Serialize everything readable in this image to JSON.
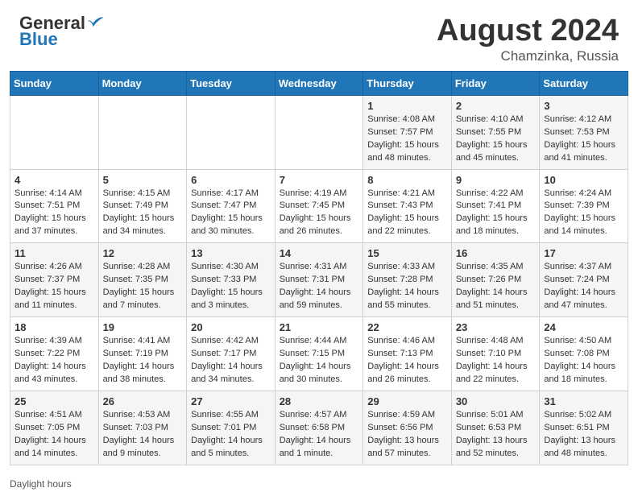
{
  "header": {
    "logo": {
      "general": "General",
      "blue": "Blue"
    },
    "month_year": "August 2024",
    "location": "Chamzinka, Russia"
  },
  "days_of_week": [
    "Sunday",
    "Monday",
    "Tuesday",
    "Wednesday",
    "Thursday",
    "Friday",
    "Saturday"
  ],
  "weeks": [
    [
      {
        "day": "",
        "sunrise": "",
        "sunset": "",
        "daylight": ""
      },
      {
        "day": "",
        "sunrise": "",
        "sunset": "",
        "daylight": ""
      },
      {
        "day": "",
        "sunrise": "",
        "sunset": "",
        "daylight": ""
      },
      {
        "day": "",
        "sunrise": "",
        "sunset": "",
        "daylight": ""
      },
      {
        "day": "1",
        "sunrise": "Sunrise: 4:08 AM",
        "sunset": "Sunset: 7:57 PM",
        "daylight": "Daylight: 15 hours and 48 minutes."
      },
      {
        "day": "2",
        "sunrise": "Sunrise: 4:10 AM",
        "sunset": "Sunset: 7:55 PM",
        "daylight": "Daylight: 15 hours and 45 minutes."
      },
      {
        "day": "3",
        "sunrise": "Sunrise: 4:12 AM",
        "sunset": "Sunset: 7:53 PM",
        "daylight": "Daylight: 15 hours and 41 minutes."
      }
    ],
    [
      {
        "day": "4",
        "sunrise": "Sunrise: 4:14 AM",
        "sunset": "Sunset: 7:51 PM",
        "daylight": "Daylight: 15 hours and 37 minutes."
      },
      {
        "day": "5",
        "sunrise": "Sunrise: 4:15 AM",
        "sunset": "Sunset: 7:49 PM",
        "daylight": "Daylight: 15 hours and 34 minutes."
      },
      {
        "day": "6",
        "sunrise": "Sunrise: 4:17 AM",
        "sunset": "Sunset: 7:47 PM",
        "daylight": "Daylight: 15 hours and 30 minutes."
      },
      {
        "day": "7",
        "sunrise": "Sunrise: 4:19 AM",
        "sunset": "Sunset: 7:45 PM",
        "daylight": "Daylight: 15 hours and 26 minutes."
      },
      {
        "day": "8",
        "sunrise": "Sunrise: 4:21 AM",
        "sunset": "Sunset: 7:43 PM",
        "daylight": "Daylight: 15 hours and 22 minutes."
      },
      {
        "day": "9",
        "sunrise": "Sunrise: 4:22 AM",
        "sunset": "Sunset: 7:41 PM",
        "daylight": "Daylight: 15 hours and 18 minutes."
      },
      {
        "day": "10",
        "sunrise": "Sunrise: 4:24 AM",
        "sunset": "Sunset: 7:39 PM",
        "daylight": "Daylight: 15 hours and 14 minutes."
      }
    ],
    [
      {
        "day": "11",
        "sunrise": "Sunrise: 4:26 AM",
        "sunset": "Sunset: 7:37 PM",
        "daylight": "Daylight: 15 hours and 11 minutes."
      },
      {
        "day": "12",
        "sunrise": "Sunrise: 4:28 AM",
        "sunset": "Sunset: 7:35 PM",
        "daylight": "Daylight: 15 hours and 7 minutes."
      },
      {
        "day": "13",
        "sunrise": "Sunrise: 4:30 AM",
        "sunset": "Sunset: 7:33 PM",
        "daylight": "Daylight: 15 hours and 3 minutes."
      },
      {
        "day": "14",
        "sunrise": "Sunrise: 4:31 AM",
        "sunset": "Sunset: 7:31 PM",
        "daylight": "Daylight: 14 hours and 59 minutes."
      },
      {
        "day": "15",
        "sunrise": "Sunrise: 4:33 AM",
        "sunset": "Sunset: 7:28 PM",
        "daylight": "Daylight: 14 hours and 55 minutes."
      },
      {
        "day": "16",
        "sunrise": "Sunrise: 4:35 AM",
        "sunset": "Sunset: 7:26 PM",
        "daylight": "Daylight: 14 hours and 51 minutes."
      },
      {
        "day": "17",
        "sunrise": "Sunrise: 4:37 AM",
        "sunset": "Sunset: 7:24 PM",
        "daylight": "Daylight: 14 hours and 47 minutes."
      }
    ],
    [
      {
        "day": "18",
        "sunrise": "Sunrise: 4:39 AM",
        "sunset": "Sunset: 7:22 PM",
        "daylight": "Daylight: 14 hours and 43 minutes."
      },
      {
        "day": "19",
        "sunrise": "Sunrise: 4:41 AM",
        "sunset": "Sunset: 7:19 PM",
        "daylight": "Daylight: 14 hours and 38 minutes."
      },
      {
        "day": "20",
        "sunrise": "Sunrise: 4:42 AM",
        "sunset": "Sunset: 7:17 PM",
        "daylight": "Daylight: 14 hours and 34 minutes."
      },
      {
        "day": "21",
        "sunrise": "Sunrise: 4:44 AM",
        "sunset": "Sunset: 7:15 PM",
        "daylight": "Daylight: 14 hours and 30 minutes."
      },
      {
        "day": "22",
        "sunrise": "Sunrise: 4:46 AM",
        "sunset": "Sunset: 7:13 PM",
        "daylight": "Daylight: 14 hours and 26 minutes."
      },
      {
        "day": "23",
        "sunrise": "Sunrise: 4:48 AM",
        "sunset": "Sunset: 7:10 PM",
        "daylight": "Daylight: 14 hours and 22 minutes."
      },
      {
        "day": "24",
        "sunrise": "Sunrise: 4:50 AM",
        "sunset": "Sunset: 7:08 PM",
        "daylight": "Daylight: 14 hours and 18 minutes."
      }
    ],
    [
      {
        "day": "25",
        "sunrise": "Sunrise: 4:51 AM",
        "sunset": "Sunset: 7:05 PM",
        "daylight": "Daylight: 14 hours and 14 minutes."
      },
      {
        "day": "26",
        "sunrise": "Sunrise: 4:53 AM",
        "sunset": "Sunset: 7:03 PM",
        "daylight": "Daylight: 14 hours and 9 minutes."
      },
      {
        "day": "27",
        "sunrise": "Sunrise: 4:55 AM",
        "sunset": "Sunset: 7:01 PM",
        "daylight": "Daylight: 14 hours and 5 minutes."
      },
      {
        "day": "28",
        "sunrise": "Sunrise: 4:57 AM",
        "sunset": "Sunset: 6:58 PM",
        "daylight": "Daylight: 14 hours and 1 minute."
      },
      {
        "day": "29",
        "sunrise": "Sunrise: 4:59 AM",
        "sunset": "Sunset: 6:56 PM",
        "daylight": "Daylight: 13 hours and 57 minutes."
      },
      {
        "day": "30",
        "sunrise": "Sunrise: 5:01 AM",
        "sunset": "Sunset: 6:53 PM",
        "daylight": "Daylight: 13 hours and 52 minutes."
      },
      {
        "day": "31",
        "sunrise": "Sunrise: 5:02 AM",
        "sunset": "Sunset: 6:51 PM",
        "daylight": "Daylight: 13 hours and 48 minutes."
      }
    ]
  ],
  "footer": {
    "daylight_label": "Daylight hours"
  }
}
